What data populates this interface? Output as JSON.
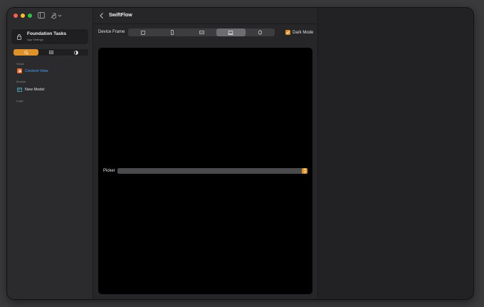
{
  "window": {
    "title": "SwiftFlow"
  },
  "sidebar": {
    "project": {
      "name": "Foundation Tasks",
      "subtitle": "App Settings"
    },
    "segments": [
      {
        "icon": "magnifier-icon",
        "active": true
      },
      {
        "icon": "grid-icon",
        "active": false
      },
      {
        "icon": "contrast-icon",
        "active": false
      }
    ],
    "sections": {
      "views": {
        "label": "Views",
        "items": [
          {
            "label": "Content View",
            "icon": "swift-icon",
            "selected": true
          }
        ]
      },
      "models": {
        "label": "Models",
        "items": [
          {
            "label": "New Model",
            "icon": "table-icon",
            "selected": false
          }
        ]
      },
      "logic": {
        "label": "Logic"
      }
    }
  },
  "toolbar": {
    "device_frame_label": "Device Frame",
    "devices": [
      {
        "icon": "ipad-icon",
        "active": false
      },
      {
        "icon": "iphone-icon",
        "active": false
      },
      {
        "icon": "tv-icon",
        "active": false
      },
      {
        "icon": "laptop-icon",
        "active": true
      },
      {
        "icon": "watch-icon",
        "active": false
      }
    ],
    "dark_mode_label": "Dark Mode",
    "dark_mode_checked": true
  },
  "canvas": {
    "picker_label": "Picker"
  },
  "colors": {
    "accent": "#e0922a",
    "link": "#4a9eff"
  }
}
